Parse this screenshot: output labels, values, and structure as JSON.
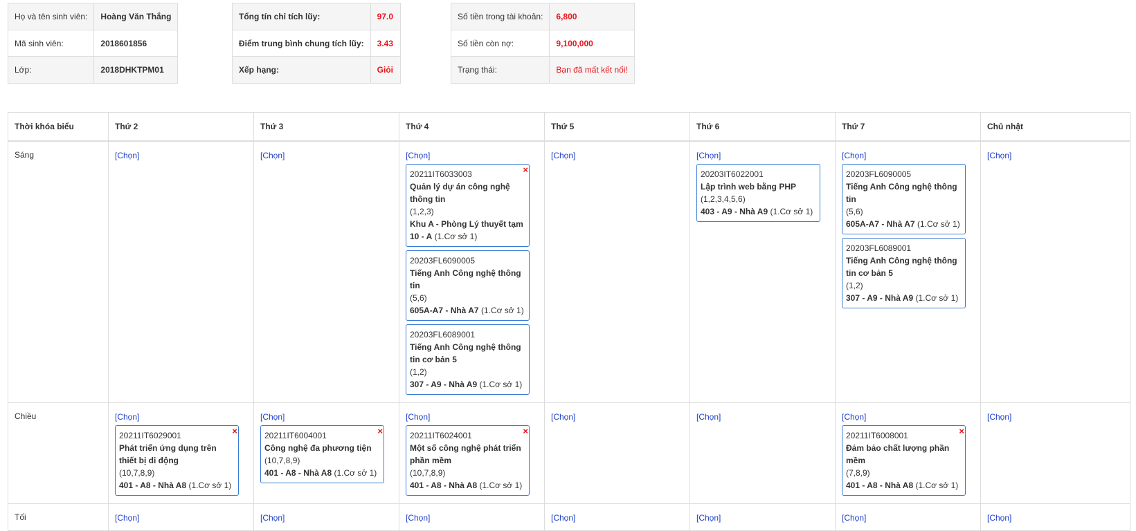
{
  "student": {
    "rows": [
      {
        "label": "Họ và tên sinh viên:",
        "value": "Hoàng Văn Thắng"
      },
      {
        "label": "Mã sinh viên:",
        "value": "2018601856"
      },
      {
        "label": "Lớp:",
        "value": "2018DHKTPM01"
      }
    ]
  },
  "academic": {
    "rows": [
      {
        "label": "Tổng tín chỉ tích lũy:",
        "value": "97.0"
      },
      {
        "label": "Điểm trung bình chung tích lũy:",
        "value": "3.43"
      },
      {
        "label": "Xếp hạng:",
        "value": "Giỏi"
      }
    ]
  },
  "account": {
    "rows": [
      {
        "label": "Số tiền trong tài khoản:",
        "value": "6,800"
      },
      {
        "label": "Số tiền còn nợ:",
        "value": "9,100,000"
      },
      {
        "label": "Trạng thái:",
        "value": "Bạn đã mất kết nối!"
      }
    ]
  },
  "timetable": {
    "corner": "Thời khóa biểu",
    "days": [
      "Thứ 2",
      "Thứ 3",
      "Thứ 4",
      "Thứ 5",
      "Thứ 6",
      "Thứ 7",
      "Chủ nhật"
    ],
    "pick_label": "[Chọn]",
    "delete_icon": "×",
    "sessions": [
      {
        "name": "Sáng",
        "cells": [
          [],
          [],
          [
            {
              "code": "20211IT6033003",
              "name": "Quản lý dự án công nghệ thông tin",
              "periods": "(1,2,3)",
              "room": "Khu A - Phòng Lý thuyết tạm 10 - A",
              "campus": "(1.Cơ sở 1)",
              "deletable": true
            },
            {
              "code": "20203FL6090005",
              "name": "Tiếng Anh Công nghệ thông tin",
              "periods": "(5,6)",
              "room": "605A-A7 - Nhà A7",
              "campus": "(1.Cơ sở 1)",
              "deletable": false
            },
            {
              "code": "20203FL6089001",
              "name": "Tiếng Anh Công nghệ thông tin cơ bản 5",
              "periods": "(1,2)",
              "room": "307 - A9 - Nhà A9",
              "campus": "(1.Cơ sở 1)",
              "deletable": false
            }
          ],
          [],
          [
            {
              "code": "20203IT6022001",
              "name": "Lập trình web bằng PHP",
              "periods": "(1,2,3,4,5,6)",
              "room": "403 - A9 - Nhà A9",
              "campus": "(1.Cơ sở 1)",
              "deletable": false
            }
          ],
          [
            {
              "code": "20203FL6090005",
              "name": "Tiếng Anh Công nghệ thông tin",
              "periods": "(5,6)",
              "room": "605A-A7 - Nhà A7",
              "campus": "(1.Cơ sở 1)",
              "deletable": false
            },
            {
              "code": "20203FL6089001",
              "name": "Tiếng Anh Công nghệ thông tin cơ bản 5",
              "periods": "(1,2)",
              "room": "307 - A9 - Nhà A9",
              "campus": "(1.Cơ sở 1)",
              "deletable": false
            }
          ],
          []
        ]
      },
      {
        "name": "Chiều",
        "cells": [
          [
            {
              "code": "20211IT6029001",
              "name": "Phát triển ứng dụng trên thiết bị di động",
              "periods": "(10,7,8,9)",
              "room": "401 - A8 - Nhà A8",
              "campus": "(1.Cơ sở 1)",
              "deletable": true
            }
          ],
          [
            {
              "code": "20211IT6004001",
              "name": "Công nghệ đa phương tiện",
              "periods": "(10,7,8,9)",
              "room": "401 - A8 - Nhà A8",
              "campus": "(1.Cơ sở 1)",
              "deletable": true
            }
          ],
          [
            {
              "code": "20211IT6024001",
              "name": "Một số công nghệ phát triển phần mềm",
              "periods": "(10,7,8,9)",
              "room": "401 - A8 - Nhà A8",
              "campus": "(1.Cơ sở 1)",
              "deletable": true
            }
          ],
          [],
          [],
          [
            {
              "code": "20211IT6008001",
              "name": "Đảm bảo chất lượng phần mềm",
              "periods": "(7,8,9)",
              "room": "401 - A8 - Nhà A8",
              "campus": "(1.Cơ sở 1)",
              "deletable": true
            }
          ],
          []
        ]
      },
      {
        "name": "Tối",
        "cells": [
          [],
          [],
          [],
          [],
          [],
          [],
          []
        ]
      }
    ]
  }
}
